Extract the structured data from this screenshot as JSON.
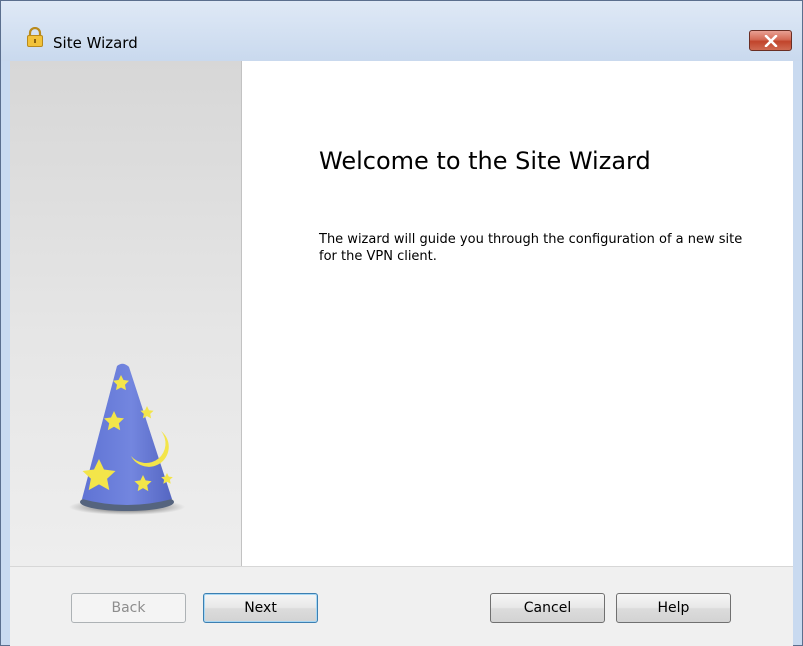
{
  "window": {
    "title": "Site Wizard",
    "title_icon": "lock-icon",
    "close_icon": "close-icon"
  },
  "side_panel": {
    "illustration": "wizard-hat-icon",
    "colors": {
      "hat": "#6c7fd6",
      "stars": "#f3e54a",
      "base": "#55647e"
    }
  },
  "main": {
    "heading": "Welcome to the Site Wizard",
    "description": "The wizard will guide you through the configuration of a new site for the VPN client."
  },
  "footer": {
    "back_label": "Back",
    "next_label": "Next",
    "cancel_label": "Cancel",
    "help_label": "Help"
  }
}
